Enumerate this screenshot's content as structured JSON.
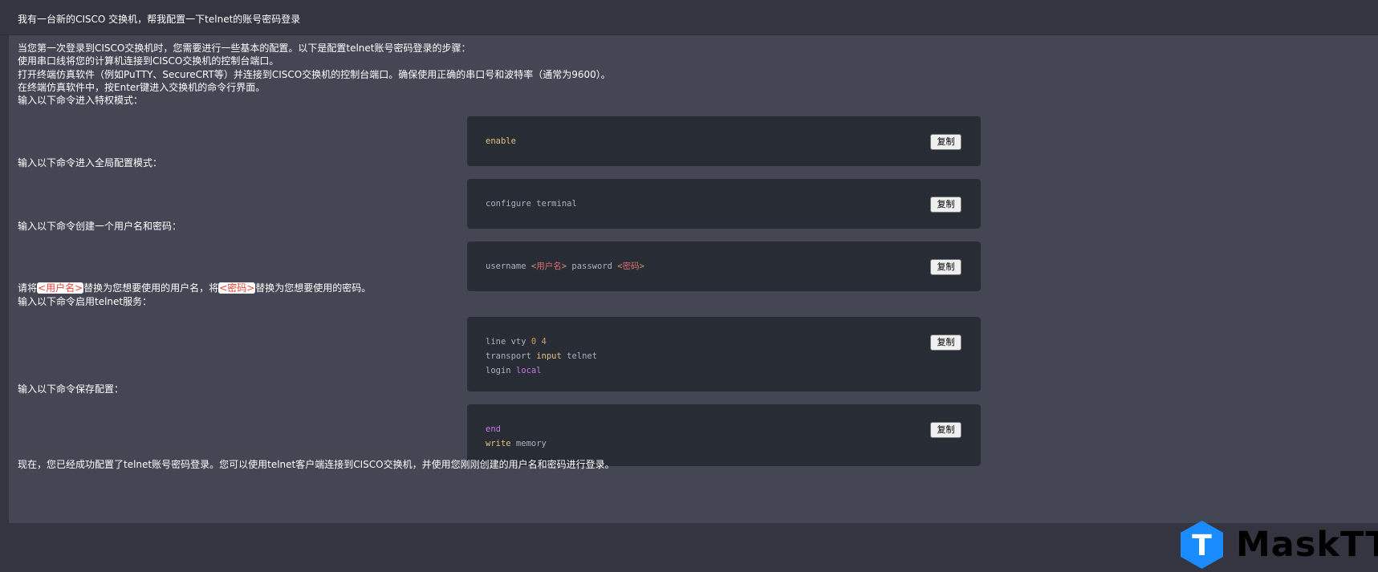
{
  "question": "我有一台新的CISCO 交换机，帮我配置一下telnet的账号密码登录",
  "intro_lines": [
    "当您第一次登录到CISCO交换机时，您需要进行一些基本的配置。以下是配置telnet账号密码登录的步骤：",
    "使用串口线将您的计算机连接到CISCO交换机的控制台端口。",
    "打开终端仿真软件（例如PuTTY、SecureCRT等）并连接到CISCO交换机的控制台端口。确保使用正确的串口号和波特率（通常为9600）。",
    "在终端仿真软件中，按Enter键进入交换机的命令行界面。"
  ],
  "steps": {
    "privileged": "输入以下命令进入特权模式：",
    "global_config": "输入以下命令进入全局配置模式：",
    "create_user": "输入以下命令创建一个用户名和密码：",
    "enable_telnet": "输入以下命令启用telnet服务：",
    "save_config": "输入以下命令保存配置："
  },
  "replace_note": {
    "prefix": "请将",
    "username_tag": "<用户名>",
    "middle": "替换为您想要使用的用户名，将",
    "password_tag": "<密码>",
    "suffix": "替换为您想要使用的密码。"
  },
  "code": {
    "enable": "enable",
    "configure": "configure terminal",
    "username_cmd": "username ",
    "username_lt": "<",
    "username_ph": "用户名",
    "username_gt": ">",
    "password_cmd": " password ",
    "password_lt": "<",
    "password_ph": "密码",
    "password_gt": ">",
    "line_vty": "line vty ",
    "vty_nums": "0 4",
    "transport": "transport ",
    "transport_input": "input",
    "transport_telnet": " telnet",
    "login": "login ",
    "login_local": "local",
    "end": "end",
    "write": "write",
    "memory": " memory"
  },
  "copy_label": "复制",
  "conclusion": "现在，您已经成功配置了telnet账号密码登录。您可以使用telnet客户端连接到CISCO交换机，并使用您刚刚创建的用户名和密码进行登录。",
  "brand": {
    "hex_letter": "T",
    "name": "MaskTT"
  },
  "colors": {
    "background": "#343541",
    "answer_bg": "#444654",
    "code_bg": "#282c34",
    "logo_blue": "#1a8cff"
  }
}
